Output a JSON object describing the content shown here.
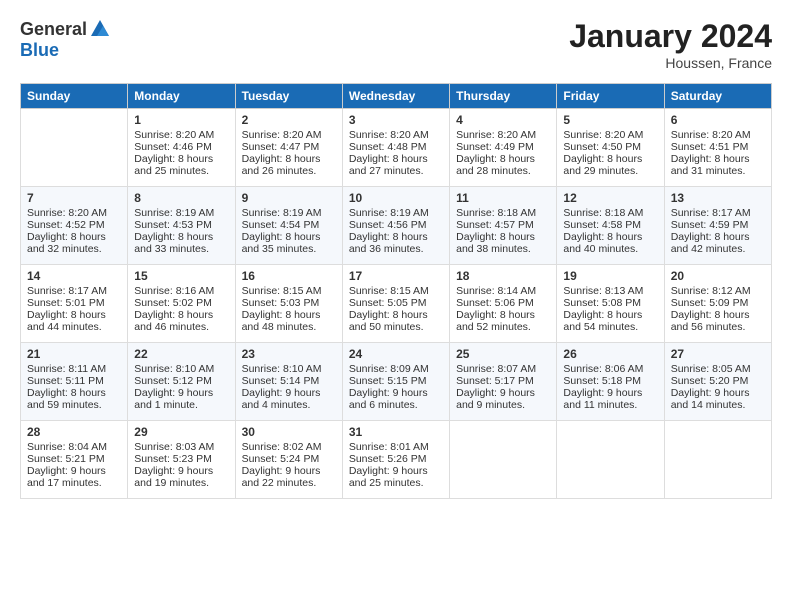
{
  "logo": {
    "general": "General",
    "blue": "Blue"
  },
  "title": "January 2024",
  "location": "Houssen, France",
  "headers": [
    "Sunday",
    "Monday",
    "Tuesday",
    "Wednesday",
    "Thursday",
    "Friday",
    "Saturday"
  ],
  "weeks": [
    [
      {
        "day": "",
        "sunrise": "",
        "sunset": "",
        "daylight": ""
      },
      {
        "day": "1",
        "sunrise": "Sunrise: 8:20 AM",
        "sunset": "Sunset: 4:46 PM",
        "daylight": "Daylight: 8 hours and 25 minutes."
      },
      {
        "day": "2",
        "sunrise": "Sunrise: 8:20 AM",
        "sunset": "Sunset: 4:47 PM",
        "daylight": "Daylight: 8 hours and 26 minutes."
      },
      {
        "day": "3",
        "sunrise": "Sunrise: 8:20 AM",
        "sunset": "Sunset: 4:48 PM",
        "daylight": "Daylight: 8 hours and 27 minutes."
      },
      {
        "day": "4",
        "sunrise": "Sunrise: 8:20 AM",
        "sunset": "Sunset: 4:49 PM",
        "daylight": "Daylight: 8 hours and 28 minutes."
      },
      {
        "day": "5",
        "sunrise": "Sunrise: 8:20 AM",
        "sunset": "Sunset: 4:50 PM",
        "daylight": "Daylight: 8 hours and 29 minutes."
      },
      {
        "day": "6",
        "sunrise": "Sunrise: 8:20 AM",
        "sunset": "Sunset: 4:51 PM",
        "daylight": "Daylight: 8 hours and 31 minutes."
      }
    ],
    [
      {
        "day": "7",
        "sunrise": "Sunrise: 8:20 AM",
        "sunset": "Sunset: 4:52 PM",
        "daylight": "Daylight: 8 hours and 32 minutes."
      },
      {
        "day": "8",
        "sunrise": "Sunrise: 8:19 AM",
        "sunset": "Sunset: 4:53 PM",
        "daylight": "Daylight: 8 hours and 33 minutes."
      },
      {
        "day": "9",
        "sunrise": "Sunrise: 8:19 AM",
        "sunset": "Sunset: 4:54 PM",
        "daylight": "Daylight: 8 hours and 35 minutes."
      },
      {
        "day": "10",
        "sunrise": "Sunrise: 8:19 AM",
        "sunset": "Sunset: 4:56 PM",
        "daylight": "Daylight: 8 hours and 36 minutes."
      },
      {
        "day": "11",
        "sunrise": "Sunrise: 8:18 AM",
        "sunset": "Sunset: 4:57 PM",
        "daylight": "Daylight: 8 hours and 38 minutes."
      },
      {
        "day": "12",
        "sunrise": "Sunrise: 8:18 AM",
        "sunset": "Sunset: 4:58 PM",
        "daylight": "Daylight: 8 hours and 40 minutes."
      },
      {
        "day": "13",
        "sunrise": "Sunrise: 8:17 AM",
        "sunset": "Sunset: 4:59 PM",
        "daylight": "Daylight: 8 hours and 42 minutes."
      }
    ],
    [
      {
        "day": "14",
        "sunrise": "Sunrise: 8:17 AM",
        "sunset": "Sunset: 5:01 PM",
        "daylight": "Daylight: 8 hours and 44 minutes."
      },
      {
        "day": "15",
        "sunrise": "Sunrise: 8:16 AM",
        "sunset": "Sunset: 5:02 PM",
        "daylight": "Daylight: 8 hours and 46 minutes."
      },
      {
        "day": "16",
        "sunrise": "Sunrise: 8:15 AM",
        "sunset": "Sunset: 5:03 PM",
        "daylight": "Daylight: 8 hours and 48 minutes."
      },
      {
        "day": "17",
        "sunrise": "Sunrise: 8:15 AM",
        "sunset": "Sunset: 5:05 PM",
        "daylight": "Daylight: 8 hours and 50 minutes."
      },
      {
        "day": "18",
        "sunrise": "Sunrise: 8:14 AM",
        "sunset": "Sunset: 5:06 PM",
        "daylight": "Daylight: 8 hours and 52 minutes."
      },
      {
        "day": "19",
        "sunrise": "Sunrise: 8:13 AM",
        "sunset": "Sunset: 5:08 PM",
        "daylight": "Daylight: 8 hours and 54 minutes."
      },
      {
        "day": "20",
        "sunrise": "Sunrise: 8:12 AM",
        "sunset": "Sunset: 5:09 PM",
        "daylight": "Daylight: 8 hours and 56 minutes."
      }
    ],
    [
      {
        "day": "21",
        "sunrise": "Sunrise: 8:11 AM",
        "sunset": "Sunset: 5:11 PM",
        "daylight": "Daylight: 8 hours and 59 minutes."
      },
      {
        "day": "22",
        "sunrise": "Sunrise: 8:10 AM",
        "sunset": "Sunset: 5:12 PM",
        "daylight": "Daylight: 9 hours and 1 minute."
      },
      {
        "day": "23",
        "sunrise": "Sunrise: 8:10 AM",
        "sunset": "Sunset: 5:14 PM",
        "daylight": "Daylight: 9 hours and 4 minutes."
      },
      {
        "day": "24",
        "sunrise": "Sunrise: 8:09 AM",
        "sunset": "Sunset: 5:15 PM",
        "daylight": "Daylight: 9 hours and 6 minutes."
      },
      {
        "day": "25",
        "sunrise": "Sunrise: 8:07 AM",
        "sunset": "Sunset: 5:17 PM",
        "daylight": "Daylight: 9 hours and 9 minutes."
      },
      {
        "day": "26",
        "sunrise": "Sunrise: 8:06 AM",
        "sunset": "Sunset: 5:18 PM",
        "daylight": "Daylight: 9 hours and 11 minutes."
      },
      {
        "day": "27",
        "sunrise": "Sunrise: 8:05 AM",
        "sunset": "Sunset: 5:20 PM",
        "daylight": "Daylight: 9 hours and 14 minutes."
      }
    ],
    [
      {
        "day": "28",
        "sunrise": "Sunrise: 8:04 AM",
        "sunset": "Sunset: 5:21 PM",
        "daylight": "Daylight: 9 hours and 17 minutes."
      },
      {
        "day": "29",
        "sunrise": "Sunrise: 8:03 AM",
        "sunset": "Sunset: 5:23 PM",
        "daylight": "Daylight: 9 hours and 19 minutes."
      },
      {
        "day": "30",
        "sunrise": "Sunrise: 8:02 AM",
        "sunset": "Sunset: 5:24 PM",
        "daylight": "Daylight: 9 hours and 22 minutes."
      },
      {
        "day": "31",
        "sunrise": "Sunrise: 8:01 AM",
        "sunset": "Sunset: 5:26 PM",
        "daylight": "Daylight: 9 hours and 25 minutes."
      },
      {
        "day": "",
        "sunrise": "",
        "sunset": "",
        "daylight": ""
      },
      {
        "day": "",
        "sunrise": "",
        "sunset": "",
        "daylight": ""
      },
      {
        "day": "",
        "sunrise": "",
        "sunset": "",
        "daylight": ""
      }
    ]
  ]
}
